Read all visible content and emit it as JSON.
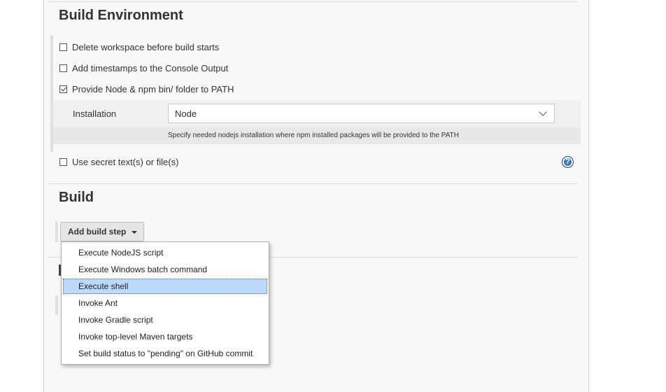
{
  "build_environment": {
    "title": "Build Environment",
    "options": [
      {
        "label": "Delete workspace before build starts",
        "checked": false
      },
      {
        "label": "Add timestamps to the Console Output",
        "checked": false
      },
      {
        "label": "Provide Node & npm bin/ folder to PATH",
        "checked": true
      }
    ],
    "installation": {
      "label": "Installation",
      "value": "Node",
      "hint": "Specify needed nodejs installation where npm installed packages will be provided to the PATH"
    },
    "secret_option": {
      "label": "Use secret text(s) or file(s)",
      "checked": false
    },
    "help_icon": "question-mark-circle-icon"
  },
  "build": {
    "title": "Build",
    "add_step_label": "Add build step",
    "menu_items": [
      {
        "label": "Execute NodeJS script",
        "selected": false
      },
      {
        "label": "Execute Windows batch command",
        "selected": false
      },
      {
        "label": "Execute shell",
        "selected": true
      },
      {
        "label": "Invoke Ant",
        "selected": false
      },
      {
        "label": "Invoke Gradle script",
        "selected": false
      },
      {
        "label": "Invoke top-level Maven targets",
        "selected": false
      },
      {
        "label": "Set build status to \"pending\" on GitHub commit",
        "selected": false
      }
    ]
  },
  "colors": {
    "panel_bg": "#f8f8f8",
    "selected_item_bg": "#bcd8fb",
    "help_icon": "#3f76b8"
  }
}
